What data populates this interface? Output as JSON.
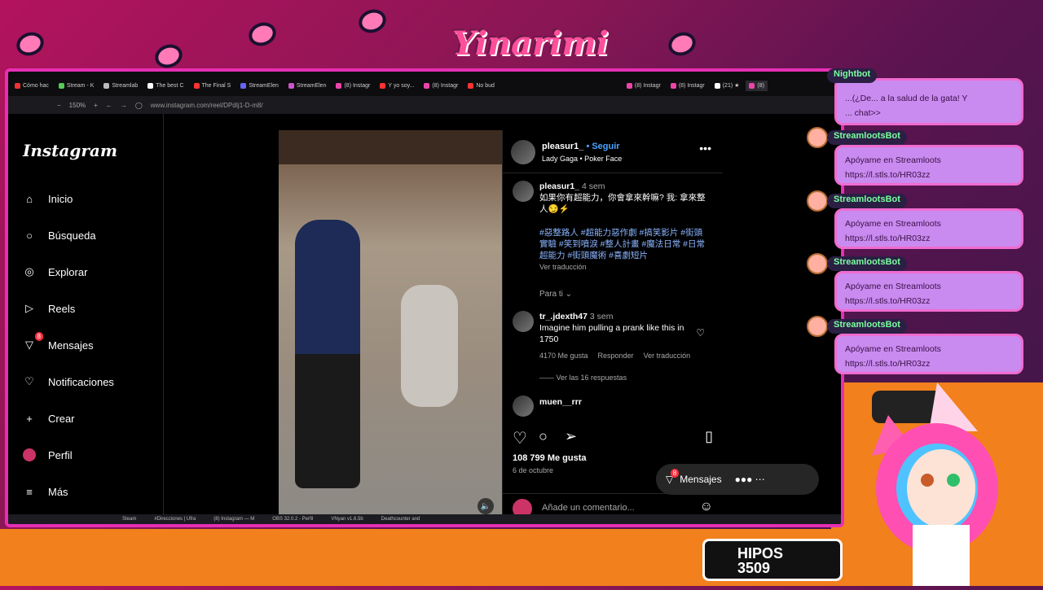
{
  "overlay": {
    "logo_text": "Yinarimi",
    "counter_label": "HIPOS",
    "counter_value": "3509",
    "chat": {
      "top_line1": "...(¿De... a la salud de la gata! Y",
      "top_line2": "... chat>>",
      "nightbot": "Nightbot",
      "bot_name": "StreamlootsBot",
      "msg_line1": "Apóyame en Streamloots",
      "msg_line2": "https://l.stls.to/HR03zz"
    }
  },
  "browser": {
    "tabs": [
      "Cómo hac",
      "Stream - K",
      "Streamlab",
      "The best C",
      "The Final S",
      "StreamElen",
      "StreamElen",
      "(8) Instagr",
      "Y yo soy...",
      "(8) Instagr",
      "No bud",
      "(8) Instagr",
      "(8) Instagr",
      "(21) ★",
      "(8)"
    ],
    "zoom": "150%",
    "url": "www.instagram.com/reel/DPdIj1-D-m8/"
  },
  "instagram": {
    "logo": "Instagram",
    "nav": [
      {
        "label": "Inicio"
      },
      {
        "label": "Búsqueda"
      },
      {
        "label": "Explorar"
      },
      {
        "label": "Reels"
      },
      {
        "label": "Mensajes",
        "badge": "8"
      },
      {
        "label": "Notificaciones"
      },
      {
        "label": "Crear"
      },
      {
        "label": "Perfil"
      },
      {
        "label": "Más"
      }
    ],
    "post": {
      "user": "pleasur1_",
      "follow": "• Seguir",
      "audio": "Lady Gaga • Poker Face",
      "caption_user": "pleasur1_",
      "caption_time": "4 sem",
      "caption": "如果你有超能力，你會拿來幹嘛? 我: 拿來整人😏⚡",
      "hashtags": "#惡整路人 #超能力惡作劇 #搞笑影片 #街頭實驗 #笑到噴淚 #整人計畫 #魔法日常 #日常超能力 #街頭魔術 #喜劇短片",
      "translate": "Ver traducción",
      "for_you": "Para ti",
      "comment_user": "tr_.jdexth47",
      "comment_time": "3 sem",
      "comment_text": "Imagine him pulling a prank like this in 1750",
      "comment_likes": "4170 Me gusta",
      "reply": "Responder",
      "comment_translate": "Ver traducción",
      "replies": "Ver las 16 respuestas",
      "comment2_user": "muen__rrr",
      "likes": "108 799 Me gusta",
      "date": "6 de octubre",
      "comment_placeholder": "Añade un comentario..."
    },
    "messages_pill": {
      "label": "Mensajes",
      "badge": "8"
    }
  },
  "taskbar": [
    "Steam",
    "#Direcciones | Ufra",
    "(8) Instagram — M",
    "OBS 32.0.2 - Perfil",
    "VNyan v1.6.5b",
    "Deathcounter and"
  ],
  "colors": {
    "accent": "#e62fb3",
    "chat_bg": "#c98bf0",
    "bot_green": "#7cffa0",
    "ig_link": "#8ab4ff"
  }
}
